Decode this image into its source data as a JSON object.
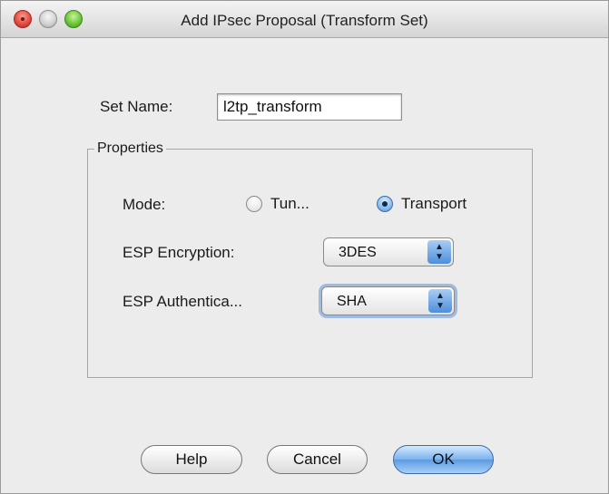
{
  "window": {
    "title": "Add IPsec Proposal (Transform Set)"
  },
  "form": {
    "set_name_label": "Set Name:",
    "set_name_value": "l2tp_transform"
  },
  "properties": {
    "group_title": "Properties",
    "mode_label": "Mode:",
    "mode_options": [
      {
        "label": "Tun...",
        "selected": false
      },
      {
        "label": "Transport",
        "selected": true
      }
    ],
    "esp_encryption_label": "ESP Encryption:",
    "esp_encryption_value": "3DES",
    "esp_authentication_label": "ESP Authentica...",
    "esp_authentication_value": "SHA"
  },
  "buttons": {
    "help": "Help",
    "cancel": "Cancel",
    "ok": "OK"
  },
  "colors": {
    "window_bg": "#ececec",
    "accent_blue": "#5b9be3",
    "close_red": "#e0473c",
    "maximize_green": "#66c234"
  },
  "icons": {
    "close": "close-icon",
    "minimize": "minimize-icon",
    "maximize": "maximize-icon",
    "popup_arrows": "up-down-arrows-icon"
  }
}
